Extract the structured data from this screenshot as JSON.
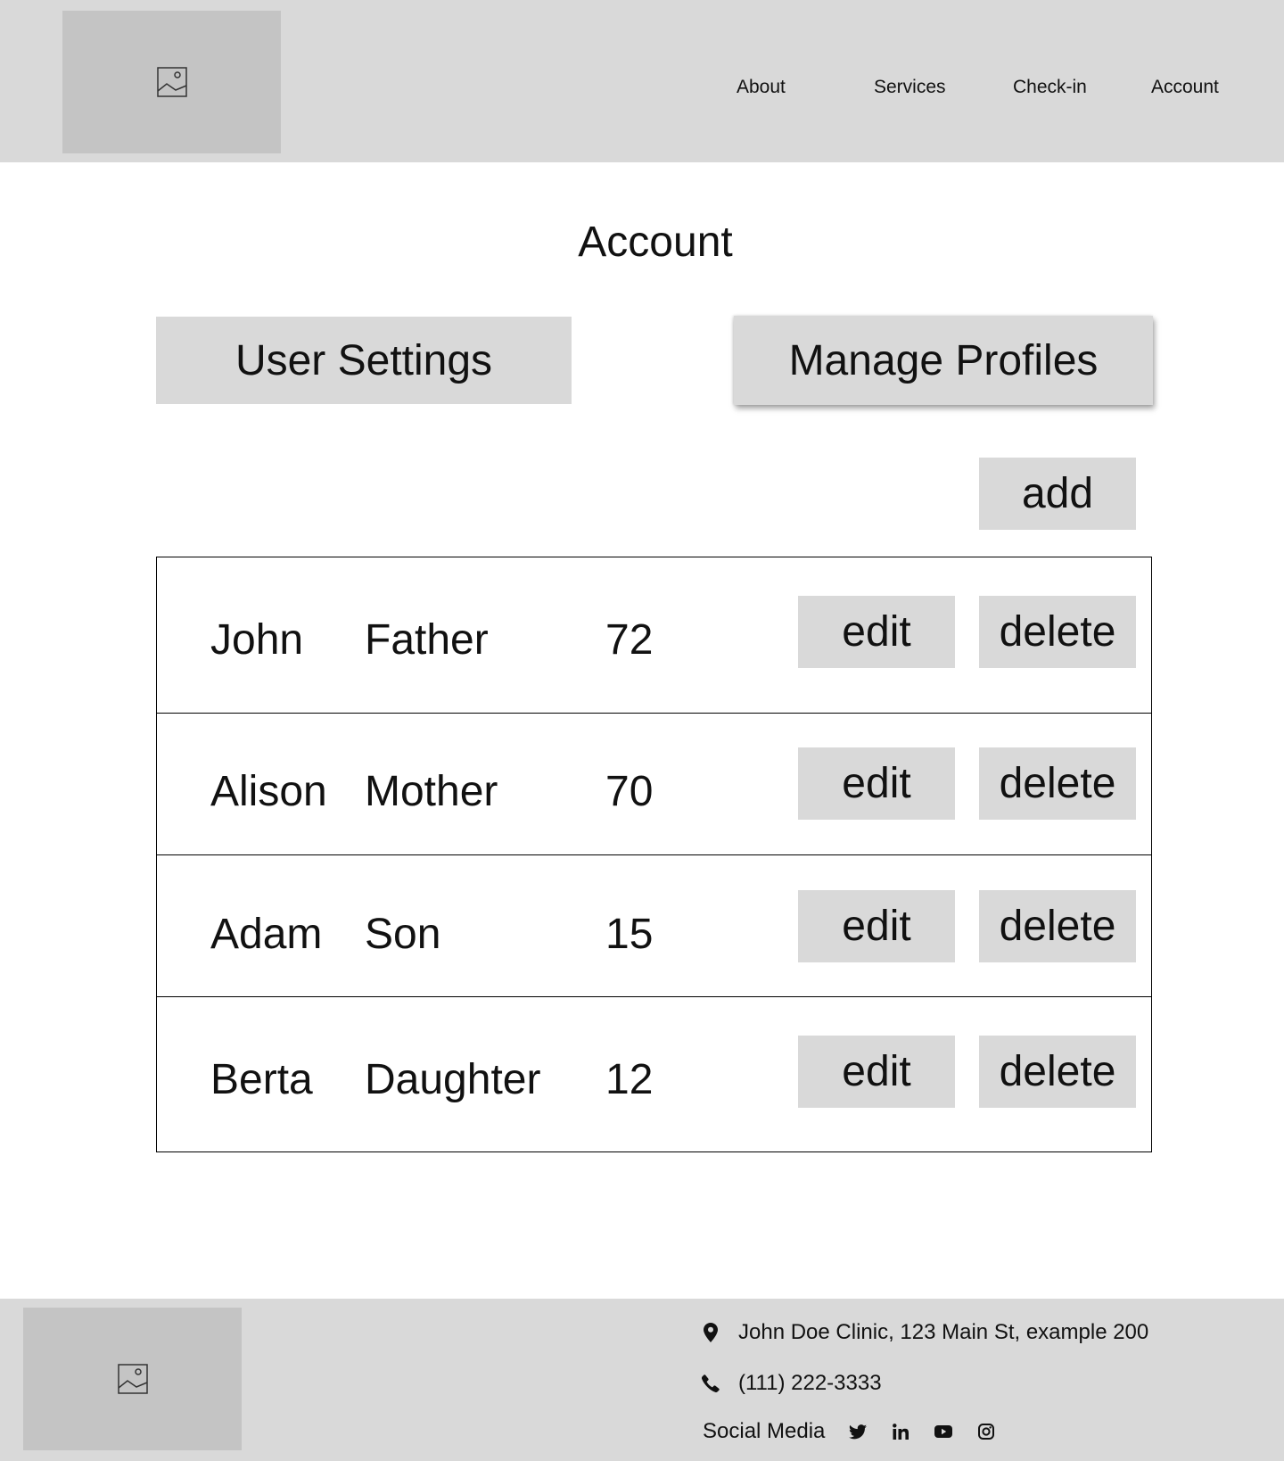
{
  "header": {
    "nav": {
      "about": "About",
      "services": "Services",
      "checkin": "Check-in",
      "account": "Account"
    }
  },
  "main": {
    "title": "Account",
    "user_settings_label": "User Settings",
    "manage_profiles_label": "Manage Profiles",
    "add_label": "add",
    "profiles": [
      {
        "name": "John",
        "relation": "Father",
        "age": "72",
        "edit": "edit",
        "delete": "delete"
      },
      {
        "name": "Alison",
        "relation": "Mother",
        "age": "70",
        "edit": "edit",
        "delete": "delete"
      },
      {
        "name": "Adam",
        "relation": "Son",
        "age": "15",
        "edit": "edit",
        "delete": "delete"
      },
      {
        "name": "Berta",
        "relation": "Daughter",
        "age": "12",
        "edit": "edit",
        "delete": "delete"
      }
    ]
  },
  "footer": {
    "address": "John Doe Clinic, 123 Main St, example 200",
    "phone": "(111) 222-3333",
    "social_label": "Social Media",
    "social_icons": [
      "twitter-icon",
      "linkedin-icon",
      "youtube-icon",
      "instagram-icon"
    ]
  },
  "colors": {
    "header_bg": "#d9d9d9",
    "placeholder_bg": "#c4c4c4",
    "button_bg": "#d9d9d9"
  }
}
